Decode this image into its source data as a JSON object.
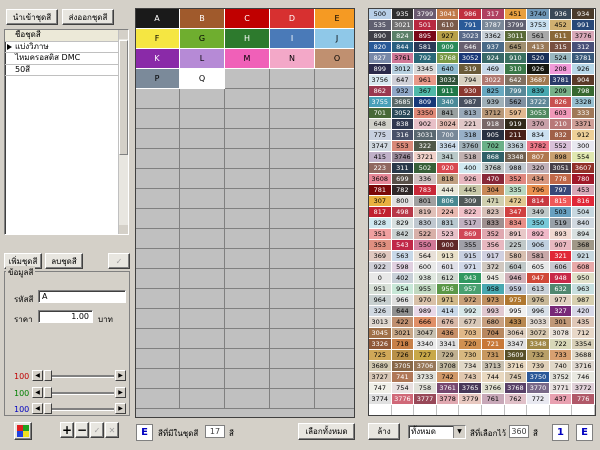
{
  "toolbar": {
    "import_label": "นำเข้าชุดสี",
    "export_label": "ส่งออกชุดสี"
  },
  "set_list": {
    "header": "ชื่อชุดสี",
    "items": [
      "แบ่งวิภาษ",
      "ไหมครอสติส DMC",
      "50สี"
    ]
  },
  "mid_buttons": {
    "add_label": "เพิ่มชุดสี",
    "delete_label": "ลบชุดสี"
  },
  "detail": {
    "title": "ข้อมูลสี",
    "code_label": "รหัสสี",
    "code_value": "A",
    "price_label": "ราคา",
    "price_value": "1.00",
    "price_unit": "บาท"
  },
  "sliders": [
    {
      "label": "100",
      "color": "#c00000",
      "value": 0
    },
    {
      "label": "100",
      "color": "#008000",
      "value": 0
    },
    {
      "label": "100",
      "color": "#0000c0",
      "value": 0
    }
  ],
  "palette": {
    "cells": [
      {
        "t": "A",
        "bg": "#1a1a1a",
        "fg": "#ffffff"
      },
      {
        "t": "B",
        "bg": "#a05a2c",
        "fg": "#ffffff"
      },
      {
        "t": "C",
        "bg": "#c00000",
        "fg": "#ffffff"
      },
      {
        "t": "D",
        "bg": "#d73030",
        "fg": "#ffffff"
      },
      {
        "t": "E",
        "bg": "#f59a23",
        "fg": "#000000"
      },
      {
        "t": "F",
        "bg": "#f5e642",
        "fg": "#000000"
      },
      {
        "t": "G",
        "bg": "#6fae2f",
        "fg": "#000000"
      },
      {
        "t": "H",
        "bg": "#2d7a2d",
        "fg": "#ffffff"
      },
      {
        "t": "I",
        "bg": "#4a7ab8",
        "fg": "#ffffff"
      },
      {
        "t": "J",
        "bg": "#8fc8e8",
        "fg": "#000000"
      },
      {
        "t": "K",
        "bg": "#8a2aa8",
        "fg": "#ffffff"
      },
      {
        "t": "L",
        "bg": "#b68ad6",
        "fg": "#000000"
      },
      {
        "t": "M",
        "bg": "#f060b8",
        "fg": "#000000"
      },
      {
        "t": "N",
        "bg": "#f3a8c8",
        "fg": "#000000"
      },
      {
        "t": "O",
        "bg": "#c09070",
        "fg": "#000000"
      },
      {
        "t": "P",
        "bg": "#7b8a9a",
        "fg": "#000000"
      },
      {
        "t": "Q",
        "bg": "#ffffff",
        "fg": "#000000"
      }
    ]
  },
  "bottom_left": {
    "e_label": "E",
    "count_label": "สีที่มีในชุดสี",
    "count_value": "17",
    "count_unit": "สี",
    "select_all_label": "เลือกทั้งหมด"
  },
  "bottom_right": {
    "clear_label": "ล้าง",
    "filter_value": "ทั้งหมด",
    "selected_label": "สีที่เลือกไว้",
    "selected_value": "360",
    "selected_unit": "สี",
    "page_value": "1",
    "e_label": "E"
  },
  "color_grid": [
    [
      "500",
      "935",
      "3799",
      "3041",
      "986",
      "317",
      "451",
      "3740",
      "936",
      "934"
    ],
    [
      "535",
      "3021",
      "501",
      "610",
      "791",
      "3787",
      "3799",
      "3753",
      "452",
      "991"
    ],
    [
      "890",
      "824",
      "895",
      "927",
      "3023",
      "3362",
      "3011",
      "561",
      "611",
      "3776"
    ],
    [
      "820",
      "844",
      "581",
      "909",
      "646",
      "937",
      "645",
      "413",
      "315",
      "312"
    ],
    [
      "827",
      "3761",
      "792",
      "3768",
      "3052",
      "924",
      "910",
      "520",
      "524",
      "3781"
    ],
    [
      "899",
      "3012",
      "3345",
      "640",
      "319",
      "469",
      "310",
      "926",
      "208",
      "926"
    ],
    [
      "3756",
      "647",
      "961",
      "3032",
      "794",
      "3022",
      "642",
      "3687",
      "3781",
      "904"
    ],
    [
      "862",
      "932",
      "367",
      "911",
      "930",
      "825",
      "799",
      "839",
      "209",
      "798"
    ],
    [
      "3755",
      "3685",
      "809",
      "340",
      "987",
      "939",
      "562",
      "3722",
      "826",
      "3328"
    ],
    [
      "701",
      "3052",
      "3350",
      "841",
      "813",
      "3712",
      "597",
      "3053",
      "603",
      "333"
    ],
    [
      "648",
      "838",
      "902",
      "3024",
      "221",
      "918",
      "919",
      "370",
      "210",
      "3371"
    ],
    [
      "775",
      "316",
      "3031",
      "700",
      "318",
      "905",
      "211",
      "834",
      "832",
      "912"
    ],
    [
      "3747",
      "553",
      "322",
      "3364",
      "3760",
      "702",
      "3363",
      "3782",
      "552",
      "300"
    ],
    [
      "415",
      "3746",
      "3721",
      "341",
      "518",
      "868",
      "3348",
      "807",
      "898",
      "554"
    ],
    [
      "223",
      "311",
      "502",
      "920",
      "400",
      "3768",
      "988",
      "320",
      "3051",
      "3607"
    ],
    [
      "3608",
      "699",
      "336",
      "818",
      "926",
      "470",
      "352",
      "434",
      "778",
      "780"
    ],
    [
      "781",
      "782",
      "783",
      "444",
      "445",
      "304",
      "335",
      "796",
      "797",
      "453"
    ],
    [
      "307",
      "800",
      "801",
      "806",
      "309",
      "471",
      "472",
      "814",
      "815",
      "816"
    ],
    [
      "817",
      "498",
      "819",
      "224",
      "822",
      "823",
      "347",
      "349",
      "503",
      "504"
    ],
    [
      "828",
      "829",
      "830",
      "831",
      "517",
      "833",
      "834",
      "350",
      "519",
      "840"
    ],
    [
      "351",
      "842",
      "522",
      "523",
      "869",
      "352",
      "891",
      "892",
      "893",
      "894"
    ],
    [
      "353",
      "543",
      "550",
      "900",
      "355",
      "356",
      "225",
      "906",
      "907",
      "368"
    ],
    [
      "369",
      "563",
      "564",
      "913",
      "915",
      "917",
      "580",
      "581",
      "321",
      "921"
    ],
    [
      "922",
      "598",
      "600",
      "601",
      "971",
      "372",
      "604",
      "605",
      "606",
      "608"
    ],
    [
      "0",
      "402",
      "938",
      "612",
      "943",
      "945",
      "946",
      "947",
      "948",
      "950"
    ],
    [
      "951",
      "954",
      "955",
      "956",
      "957",
      "958",
      "959",
      "613",
      "632",
      "963"
    ],
    [
      "964",
      "966",
      "970",
      "971",
      "972",
      "973",
      "975",
      "976",
      "977",
      "987"
    ],
    [
      "326",
      "644",
      "989",
      "414",
      "992",
      "993",
      "995",
      "996",
      "327",
      "420"
    ],
    [
      "3013",
      "422",
      "666",
      "676",
      "677",
      "680",
      "433",
      "3033",
      "301",
      "435"
    ],
    [
      "3045",
      "3021",
      "3047",
      "436",
      "703",
      "704",
      "3064",
      "3072",
      "3078",
      "712"
    ],
    [
      "3326",
      "718",
      "3340",
      "3341",
      "720",
      "721",
      "3347",
      "3348",
      "722",
      "3354"
    ],
    [
      "725",
      "726",
      "727",
      "729",
      "730",
      "731",
      "3609",
      "732",
      "733",
      "3688"
    ],
    [
      "3689",
      "3705",
      "3706",
      "3708",
      "734",
      "3713",
      "3716",
      "739",
      "740",
      "3716"
    ],
    [
      "3727",
      "741",
      "3733",
      "742",
      "743",
      "744",
      "745",
      "3750",
      "3752",
      "746"
    ],
    [
      "747",
      "754",
      "758",
      "3761",
      "3765",
      "3766",
      "3768",
      "3770",
      "3771",
      "3772"
    ],
    [
      "3774",
      "3776",
      "3777",
      "3778",
      "3779",
      "761",
      "762",
      "772",
      "437",
      "776"
    ]
  ],
  "grid_colors": [
    [
      "#b8d0e8",
      "#303030",
      "#6a5a70",
      "#c07848",
      "#c03040",
      "#b04060",
      "#e8a040",
      "#7098b8",
      "#384858",
      "#4a3a2a"
    ],
    [
      "#606070",
      "#707070",
      "#b82840",
      "#7a5a4a",
      "#2a5a98",
      "#7a8898",
      "#606070",
      "#c8e0f0",
      "#d0b070",
      "#284878"
    ],
    [
      "#404048",
      "#5a8068",
      "#7a0818",
      "#b8a048",
      "#5a6a88",
      "#c8d0d8",
      "#5a6a38",
      "#a8a8a8",
      "#8a6838",
      "#d8a8b8"
    ],
    [
      "#2a5a98",
      "#286080",
      "#2a3a58",
      "#2a8a5a",
      "#686070",
      "#4a6a88",
      "#a09070",
      "#9a7a58",
      "#785040",
      "#485078"
    ],
    [
      "#7888a8",
      "#d07898",
      "#2a6878",
      "#7a9a48",
      "#1a3878",
      "#386868",
      "#3a7060",
      "#1a3058",
      "#9ab8c0",
      "#3a5a7a"
    ],
    [
      "#2a2a4a",
      "#b8d0e0",
      "#d8d8d8",
      "#90bcd0",
      "#6a5a38",
      "#c8d8e8",
      "#3a7848",
      "#181810",
      "#f09ad8",
      "#b8d8e8"
    ],
    [
      "#d8e8f0",
      "#d0d0d8",
      "#e89888",
      "#305038",
      "#d8d0c0",
      "#b07870",
      "#807060",
      "#a07850",
      "#2a3868",
      "#5a3a28"
    ],
    [
      "#9a3850",
      "#90a8c8",
      "#50b8a8",
      "#207848",
      "#8a3830",
      "#68a8c0",
      "#588898",
      "#48a8b0",
      "#78b088",
      "#386830"
    ],
    [
      "#48a0b8",
      "#586868",
      "#183878",
      "#4a8a98",
      "#485060",
      "#a0b0b8",
      "#8090a0",
      "#608898",
      "#c85050",
      "#98c0d0"
    ],
    [
      "#486838",
      "#284858",
      "#e08a78",
      "#98a0a0",
      "#98a8b8",
      "#b89878",
      "#e0b890",
      "#508860",
      "#f098b8",
      "#a07858"
    ],
    [
      "#d0d0c8",
      "#303850",
      "#e8c0c8",
      "#e0b8b0",
      "#e0c8c8",
      "#786868",
      "#302818",
      "#c8a0a8",
      "#b87878",
      "#d0a098"
    ],
    [
      "#c8d0e0",
      "#485068",
      "#5a6870",
      "#788898",
      "#98b0c8",
      "#283040",
      "#482018",
      "#cce0f0",
      "#a06048",
      "#eed098"
    ],
    [
      "#d0d8e0",
      "#d88878",
      "#505848",
      "#c8d8e8",
      "#a0b0b8",
      "#6ab088",
      "#c0d0d8",
      "#ec7888",
      "#d8c0d8",
      "#e8e8f0"
    ],
    [
      "#c0b0c8",
      "#988898",
      "#f0d0c8",
      "#b8c8c8",
      "#c0b0b0",
      "#306068",
      "#706050",
      "#b07850",
      "#c8a070",
      "#e0e8b0"
    ],
    [
      "#906860",
      "#283848",
      "#386038",
      "#d84850",
      "#d0e8f0",
      "#c0c8c8",
      "#c0c8d0",
      "#c0b0b8",
      "#484048",
      "#903028"
    ],
    [
      "#e88898",
      "#585048",
      "#d0c0c0",
      "#c0a080",
      "#e8b8c0",
      "#882838",
      "#e08880",
      "#d89880",
      "#c06848",
      "#a01828"
    ],
    [
      "#7a0808",
      "#302828",
      "#c82838",
      "#e8e8d8",
      "#c8c8a8",
      "#c88858",
      "#b8d8c0",
      "#e89050",
      "#384878",
      "#d8a8b8"
    ],
    [
      "#e8b040",
      "#e0e0e0",
      "#a0a0a0",
      "#488890",
      "#505858",
      "#d0d0b0",
      "#e0c890",
      "#c83840",
      "#f05858",
      "#e02838"
    ],
    [
      "#c02030",
      "#b83848",
      "#e0c0b8",
      "#e8b8b0",
      "#f0c0c8",
      "#d8c0b8",
      "#d04040",
      "#c0c8c8",
      "#68a0c0",
      "#c8d8e0"
    ],
    [
      "#d0e8f0",
      "#d8e0e0",
      "#c0c8d0",
      "#b8c8d0",
      "#c0b0c0",
      "#a09090",
      "#e89088",
      "#78c8d8",
      "#98a0a8",
      "#d0d8e0"
    ],
    [
      "#f0a0a0",
      "#c8d0d0",
      "#d8b0a8",
      "#e8c0c8",
      "#d04858",
      "#e0a8b0",
      "#e8c8c8",
      "#f0b8c8",
      "#f0d8d0",
      "#d8e0e0"
    ],
    [
      "#e09080",
      "#c02848",
      "#d07898",
      "#602828",
      "#a0a0a8",
      "#e8b8c0",
      "#c0c8c8",
      "#c0d0e0",
      "#e8b8c0",
      "#a09888"
    ],
    [
      "#e0c8c0",
      "#c8d8e8",
      "#e8e0d8",
      "#e8e0c8",
      "#c8d0e0",
      "#d0d0e0",
      "#d8c0b0",
      "#c8a8a8",
      "#e02838",
      "#c8d8e0"
    ],
    [
      "#d0d0d8",
      "#e0d0e0",
      "#e8e8e8",
      "#e0e0e8",
      "#d0d8e8",
      "#d0c8c0",
      "#c0c8c8",
      "#e8e8e8",
      "#c8c8d0",
      "#e8a8a8"
    ],
    [
      "#e8e8e8",
      "#c8d0d8",
      "#e0e8e0",
      "#d0d8d0",
      "#309860",
      "#e8e8e0",
      "#d0b0b8",
      "#d04838",
      "#c82848",
      "#e0e0c8"
    ],
    [
      "#d8e0d8",
      "#c8e8d8",
      "#c0d8c0",
      "#5a9848",
      "#48a070",
      "#48a8b0",
      "#c0c8d8",
      "#c8d0d8",
      "#508870",
      "#c8e0e0"
    ],
    [
      "#c8d0d0",
      "#e0e0e0",
      "#d8c0a8",
      "#d0b888",
      "#c8a078",
      "#c09060",
      "#b07830",
      "#c8b898",
      "#e0d0c0",
      "#d8d0b0"
    ],
    [
      "#d0d8e0",
      "#909090",
      "#e8d8e8",
      "#c8d8e8",
      "#d8e8e8",
      "#e0c8d0",
      "#f0f0f0",
      "#d8e0e8",
      "#782878",
      "#d8d8e8"
    ],
    [
      "#e0d8d0",
      "#c09070",
      "#e09068",
      "#d8b8a8",
      "#d8c8b8",
      "#c8a080",
      "#b88850",
      "#e0d8d0",
      "#c09878",
      "#e0c8b8"
    ],
    [
      "#a07048",
      "#c8a888",
      "#c8c0b0",
      "#c89068",
      "#e0b888",
      "#b88860",
      "#e0d0c0",
      "#d8c8b0",
      "#e8e0d8",
      "#e8d8c8"
    ],
    [
      "#905838",
      "#c88048",
      "#e8e8e8",
      "#e0e0e0",
      "#d09050",
      "#c87838",
      "#e0e0e0",
      "#a08848",
      "#d8d8b8",
      "#d8d0b8"
    ],
    [
      "#d0a858",
      "#b89048",
      "#c8a848",
      "#c0b090",
      "#d8b880",
      "#c89860",
      "#585028",
      "#b8a068",
      "#d8a070",
      "#e0d8c8"
    ],
    [
      "#d0c8b0",
      "#886848",
      "#987858",
      "#c0b8a0",
      "#e0d8c8",
      "#c8c0b0",
      "#e8d8c0",
      "#e0d0b8",
      "#e0d8c8",
      "#e0d8d0"
    ],
    [
      "#d8c8b8",
      "#b07858",
      "#e0e0d8",
      "#d09868",
      "#e0c8b0",
      "#e8d8c0",
      "#d8c8b0",
      "#2a5898",
      "#e0e0d8",
      "#e8e8e0"
    ],
    [
      "#f0f0e8",
      "#e8e0e0",
      "#e0e0d8",
      "#784870",
      "#483858",
      "#e0e0d0",
      "#584068",
      "#786888",
      "#e8e0e0",
      "#e0d0d8"
    ],
    [
      "#e0e0e0",
      "#d06878",
      "#984858",
      "#e0a8b0",
      "#e8c8c0",
      "#c8a8b8",
      "#e0c0c8",
      "#e8e8f0",
      "#e8a0b0",
      "#b05868"
    ]
  ]
}
